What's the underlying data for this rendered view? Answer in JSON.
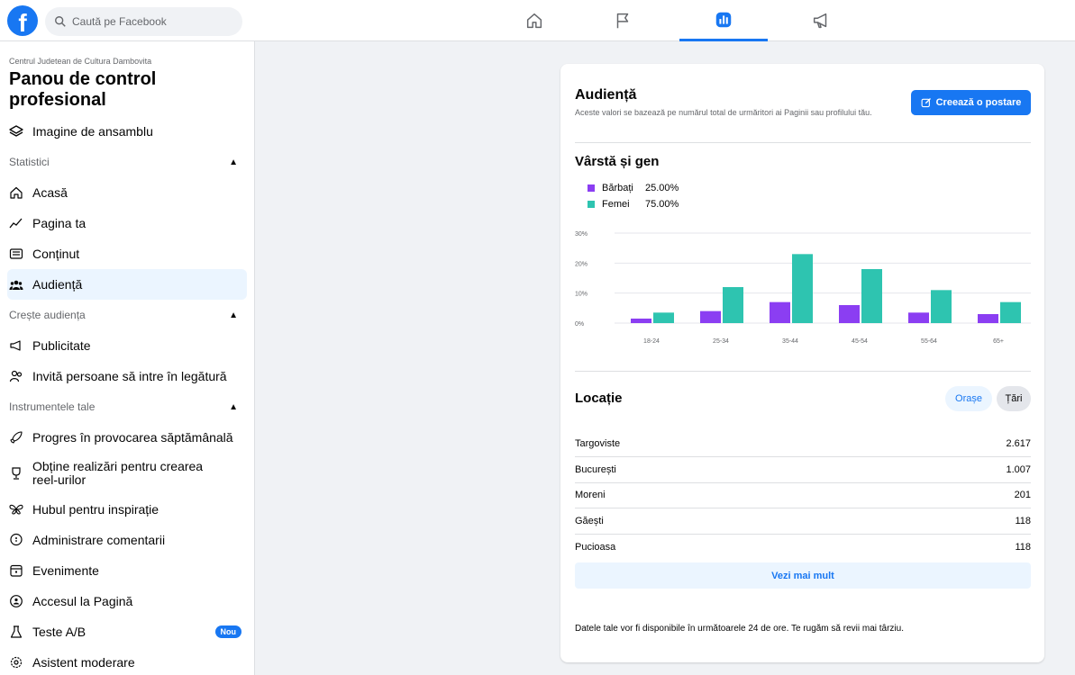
{
  "topbar": {
    "logo": "f",
    "search_placeholder": "Caută pe Facebook",
    "tabs": [
      "home-icon",
      "flag-icon",
      "insights-icon",
      "megaphone-icon"
    ]
  },
  "sidebar": {
    "page_name": "Centrul Judetean de Cultura Dambovita",
    "title": "Panou de control profesional",
    "overview": "Imagine de ansamblu",
    "section_stats": "Statistici",
    "stats_items": [
      "Acasă",
      "Pagina ta",
      "Conținut",
      "Audiență"
    ],
    "section_grow": "Crește audiența",
    "grow_items": [
      "Publicitate",
      "Invită persoane să intre în legătură"
    ],
    "section_tools": "Instrumentele tale",
    "tools_items": [
      "Progres în provocarea săptămânală",
      "Obține realizări pentru crearea reel-urilor",
      "Hubul pentru inspirație",
      "Administrare comentarii",
      "Evenimente",
      "Accesul la Pagină",
      "Teste A/B",
      "Asistent moderare"
    ],
    "badge_new": "Nou"
  },
  "card": {
    "title": "Audiență",
    "description": "Aceste valori se bazează pe numărul total de urmăritori ai Paginii sau profilului tău.",
    "create_button": "Creează o postare",
    "age_gender_title": "Vârstă și gen",
    "legend": [
      {
        "name": "Bărbați",
        "value": "25.00%"
      },
      {
        "name": "Femei",
        "value": "75.00%"
      }
    ],
    "location_title": "Locație",
    "toggle_cities": "Orașe",
    "toggle_countries": "Țări",
    "locations": [
      {
        "name": "Targoviste",
        "value": "2.617"
      },
      {
        "name": "București",
        "value": "1.007"
      },
      {
        "name": "Moreni",
        "value": "201"
      },
      {
        "name": "Găești",
        "value": "118"
      },
      {
        "name": "Pucioasa",
        "value": "118"
      }
    ],
    "see_more": "Vezi mai mult",
    "footer_note": "Datele tale vor fi disponibile în următoarele 24 de ore. Te rugăm să revii mai târziu."
  },
  "colors": {
    "accent": "#1877f2",
    "men": "#8b3ef2",
    "women": "#2ec4b0"
  },
  "chart_data": {
    "type": "bar",
    "categories": [
      "18-24",
      "25-34",
      "35-44",
      "45-54",
      "55-64",
      "65+"
    ],
    "series": [
      {
        "name": "Bărbați",
        "values": [
          1.5,
          4,
          7,
          6,
          3.5,
          3
        ]
      },
      {
        "name": "Femei",
        "values": [
          3.5,
          12,
          23,
          18,
          11,
          7
        ]
      }
    ],
    "ylim": [
      0,
      30
    ],
    "yticks": [
      "0%",
      "10%",
      "20%",
      "30%"
    ],
    "grid": true
  }
}
